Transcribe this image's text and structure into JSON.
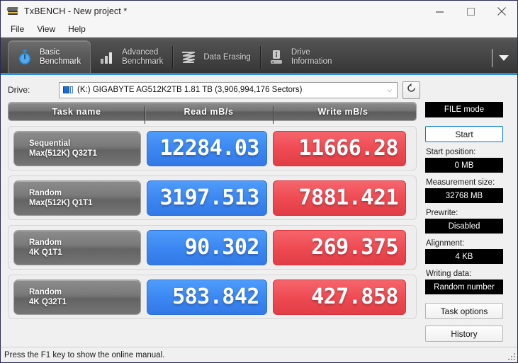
{
  "window": {
    "title": "TxBENCH - New project *",
    "app_icon": "txbench-app-icon",
    "minimize": "minimize-icon",
    "maximize": "maximize-icon",
    "close": "close-icon"
  },
  "menu": {
    "items": [
      {
        "label": "File"
      },
      {
        "label": "View"
      },
      {
        "label": "Help"
      }
    ]
  },
  "tabs": {
    "items": [
      {
        "label": "Basic\nBenchmark",
        "icon": "stopwatch-icon",
        "active": true
      },
      {
        "label": "Advanced\nBenchmark",
        "icon": "bar-chart-icon",
        "active": false
      },
      {
        "label": "Data Erasing",
        "icon": "shredder-icon",
        "active": false
      },
      {
        "label": "Drive\nInformation",
        "icon": "drive-info-icon",
        "active": false
      }
    ],
    "overflow_icon": "chevron-down-icon"
  },
  "drive": {
    "label": "Drive:",
    "selected": "(K:) GIGABYTE AG512K2TB  1.81 TB (3,906,994,176 Sectors)",
    "drive_icon": "disk-drive-icon",
    "dropdown_icon": "chevron-down-icon",
    "refresh_icon": "refresh-icon"
  },
  "benchmark": {
    "headers": {
      "task": "Task name",
      "read": "Read mB/s",
      "write": "Write mB/s"
    },
    "rows": [
      {
        "task": "Sequential\nMax(512K) Q32T1",
        "read": "12284.03",
        "write": "11666.28"
      },
      {
        "task": "Random\nMax(512K) Q1T1",
        "read": "3197.513",
        "write": "7881.421"
      },
      {
        "task": "Random\n4K Q1T1",
        "read": "90.302",
        "write": "269.375"
      },
      {
        "task": "Random\n4K Q32T1",
        "read": "583.842",
        "write": "427.858"
      }
    ],
    "colors": {
      "read": "#3b87f2",
      "write": "#ef4a52",
      "header": "#747474",
      "task_button": "#7a7a7a"
    }
  },
  "side": {
    "file_mode": "FILE mode",
    "start": "Start",
    "start_position_label": "Start position:",
    "start_position_value": "0 MB",
    "measurement_size_label": "Measurement size:",
    "measurement_size_value": "32768 MB",
    "prewrite_label": "Prewrite:",
    "prewrite_value": "Disabled",
    "alignment_label": "Alignment:",
    "alignment_value": "4 KB",
    "writing_data_label": "Writing data:",
    "writing_data_value": "Random number",
    "task_options": "Task options",
    "history": "History"
  },
  "statusbar": {
    "text": "Press the F1 key to show the online manual.",
    "grip_icon": "resize-grip-icon"
  }
}
